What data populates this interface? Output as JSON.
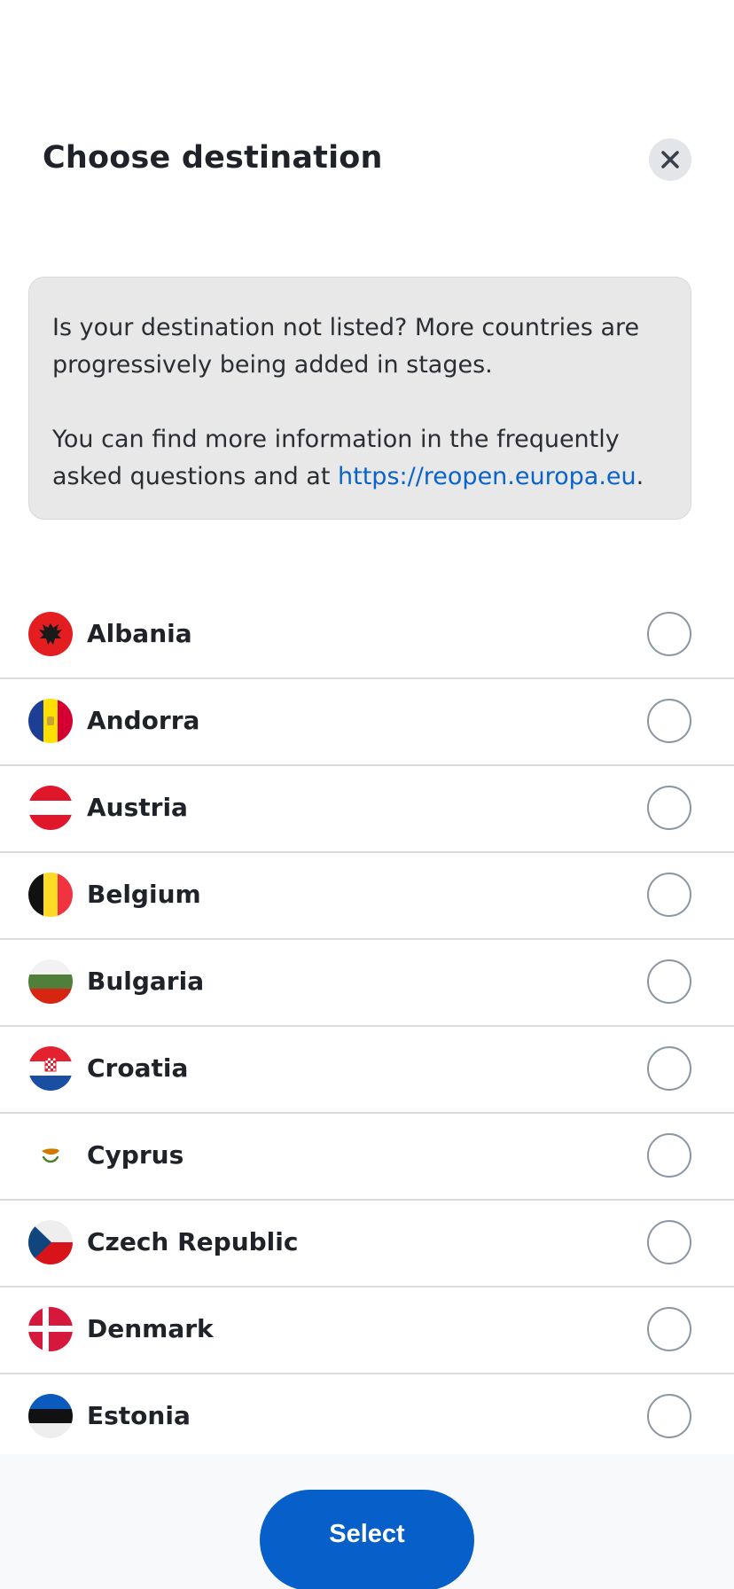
{
  "header": {
    "title": "Choose destination",
    "close_icon": "close-icon"
  },
  "info": {
    "paragraph1": "Is your destination not listed? More countries are progressively being added in stages.",
    "paragraph2_prefix": "You can find more information in the frequently asked questions and at ",
    "link_text": "https://reopen.europa.eu",
    "paragraph2_suffix": "."
  },
  "countries": [
    {
      "name": "Albania",
      "flag": "albania-flag-icon",
      "selected": false
    },
    {
      "name": "Andorra",
      "flag": "andorra-flag-icon",
      "selected": false
    },
    {
      "name": "Austria",
      "flag": "austria-flag-icon",
      "selected": false
    },
    {
      "name": "Belgium",
      "flag": "belgium-flag-icon",
      "selected": false
    },
    {
      "name": "Bulgaria",
      "flag": "bulgaria-flag-icon",
      "selected": false
    },
    {
      "name": "Croatia",
      "flag": "croatia-flag-icon",
      "selected": false
    },
    {
      "name": "Cyprus",
      "flag": "cyprus-flag-icon",
      "selected": false
    },
    {
      "name": "Czech Republic",
      "flag": "czech-republic-flag-icon",
      "selected": false
    },
    {
      "name": "Denmark",
      "flag": "denmark-flag-icon",
      "selected": false
    },
    {
      "name": "Estonia",
      "flag": "estonia-flag-icon",
      "selected": false
    }
  ],
  "footer": {
    "select_label": "Select"
  },
  "colors": {
    "primary": "#0760c9",
    "link": "#0a63c9",
    "info_bg": "#e8e8e8",
    "radio_border": "#8b96a3"
  }
}
